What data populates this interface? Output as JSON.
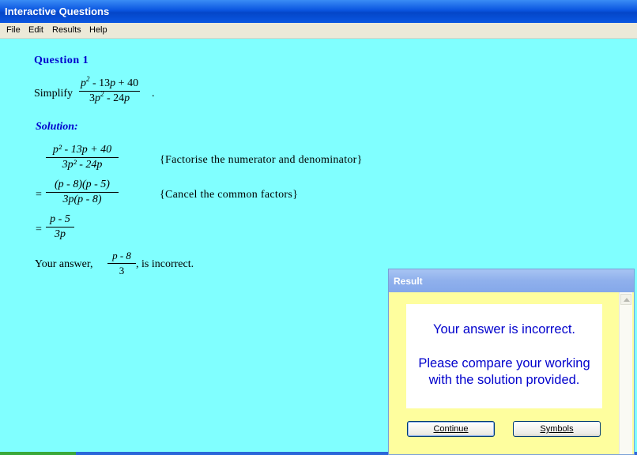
{
  "window": {
    "title": "Interactive Questions"
  },
  "menu": [
    "File",
    "Edit",
    "Results",
    "Help"
  ],
  "question": {
    "title": "Question 1",
    "prompt": "Simplify",
    "expr_num_a": "p",
    "expr_num_b": " - 13",
    "expr_num_c": "p",
    "expr_num_d": " + 40",
    "expr_den_a": "3",
    "expr_den_b": "p",
    "expr_den_c": " - 24",
    "expr_den_d": "p",
    "period": "."
  },
  "solution": {
    "title": "Solution:",
    "step1_num": "p² - 13p + 40",
    "step1_den": "3p² - 24p",
    "step1_note": "{Factorise the numerator and denominator}",
    "eq": "=",
    "step2_num": "(p - 8)(p - 5)",
    "step2_den": "3p(p - 8)",
    "step2_note": "{Cancel the common factors}",
    "step3_num": "p - 5",
    "step3_den": "3p"
  },
  "answer": {
    "prefix": "Your answer,",
    "num": "p - 8",
    "den": "3",
    "suffix": ", is incorrect."
  },
  "dialog": {
    "title": "Result",
    "line1": "Your answer is incorrect.",
    "line2": "Please compare your working with the solution provided.",
    "continue_label": "Continue",
    "symbols_label": "Symbols"
  }
}
